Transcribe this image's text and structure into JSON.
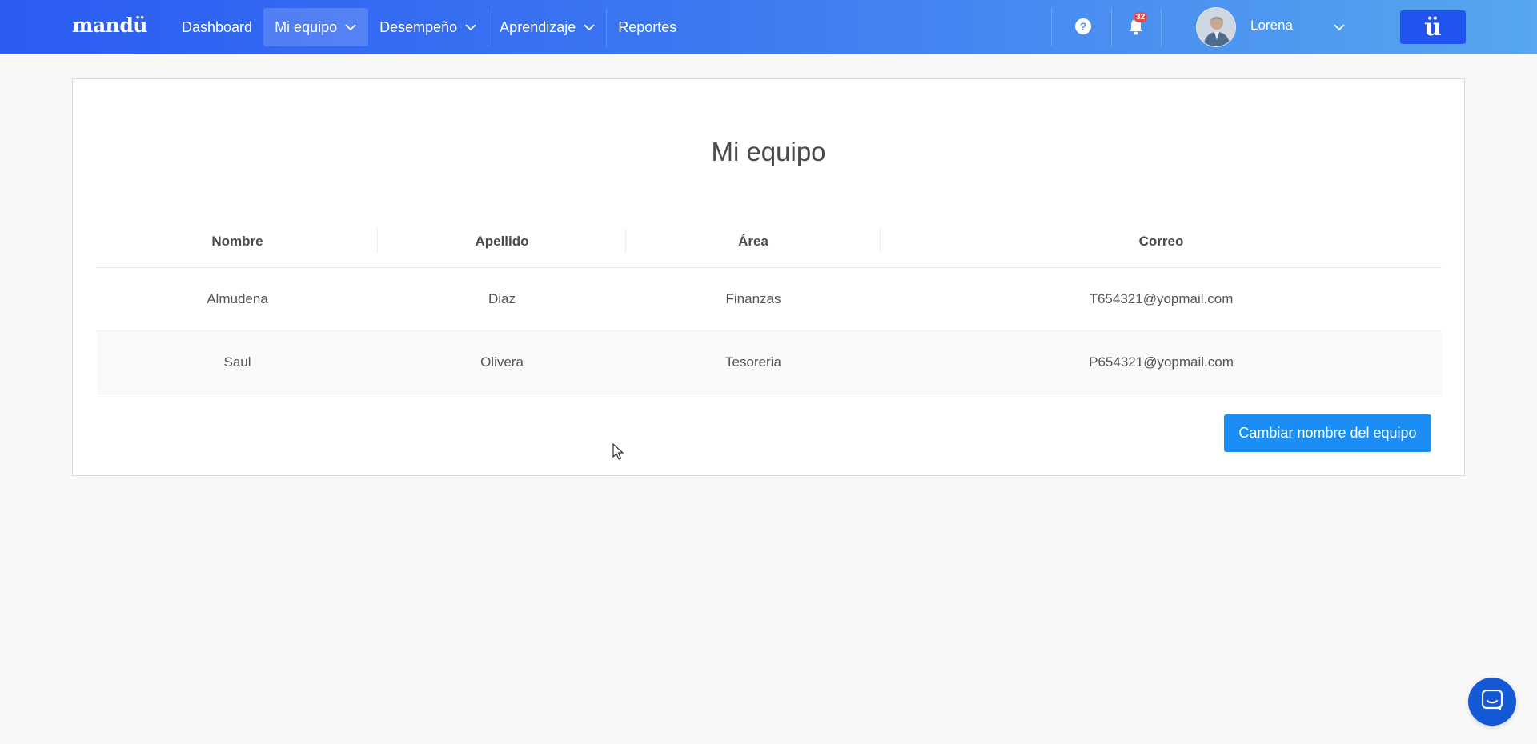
{
  "header": {
    "logo": "mandü",
    "nav": [
      {
        "label": "Dashboard",
        "dropdown": false,
        "active": false
      },
      {
        "label": "Mi equipo",
        "dropdown": true,
        "active": true
      },
      {
        "label": "Desempeño",
        "dropdown": true,
        "active": false
      },
      {
        "label": "Aprendizaje",
        "dropdown": true,
        "active": false
      },
      {
        "label": "Reportes",
        "dropdown": false,
        "active": false
      }
    ],
    "help_icon": "?",
    "notifications_count": "32",
    "user_name": "Lorena",
    "brand_button": "ü"
  },
  "main": {
    "title": "Mi equipo",
    "table": {
      "headers": [
        "Nombre",
        "Apellido",
        "Área",
        "Correo"
      ],
      "rows": [
        [
          "Almudena",
          "Diaz",
          "Finanzas",
          "T654321@yopmail.com"
        ],
        [
          "Saul",
          "Olivera",
          "Tesoreria",
          "P654321@yopmail.com"
        ]
      ]
    },
    "rename_button": "Cambiar nombre del equipo"
  },
  "colors": {
    "header_start": "#2b5cf2",
    "header_end": "#57a6ef",
    "primary_button": "#1b8ef5",
    "brand_button": "#2153f0",
    "chat_button": "#1558d6",
    "badge": "#e74c4c"
  },
  "icons": [
    "chevron-down-icon",
    "help-icon",
    "bell-icon",
    "avatar",
    "chat-icon"
  ]
}
